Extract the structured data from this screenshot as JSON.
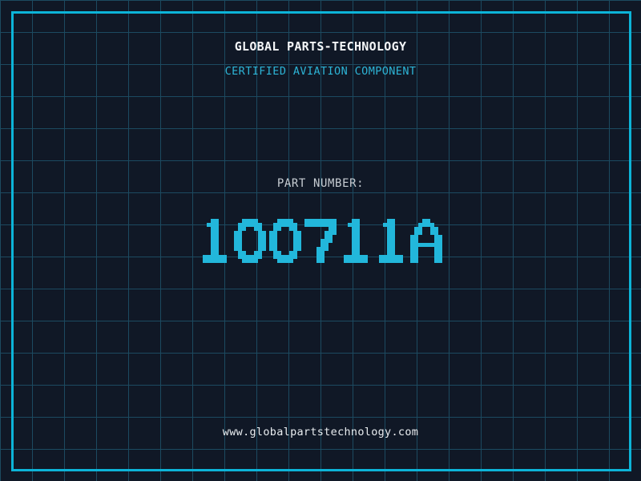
{
  "header": {
    "company": "GLOBAL PARTS-TECHNOLOGY",
    "certification": "CERTIFIED AVIATION COMPONENT"
  },
  "part": {
    "label": "PART NUMBER:",
    "number": "100711A"
  },
  "footer": {
    "website": "www.globalpartstechnology.com"
  },
  "colors": {
    "background": "#101826",
    "grid_line": "#1c4a60",
    "frame_cyan": "#0cb4d8",
    "number_cyan": "#22b7db",
    "subtitle_cyan": "#2db4d6",
    "title_white": "#f4f6f8",
    "label_gray": "#c7cdd3",
    "footer_white": "#e9edf0"
  }
}
